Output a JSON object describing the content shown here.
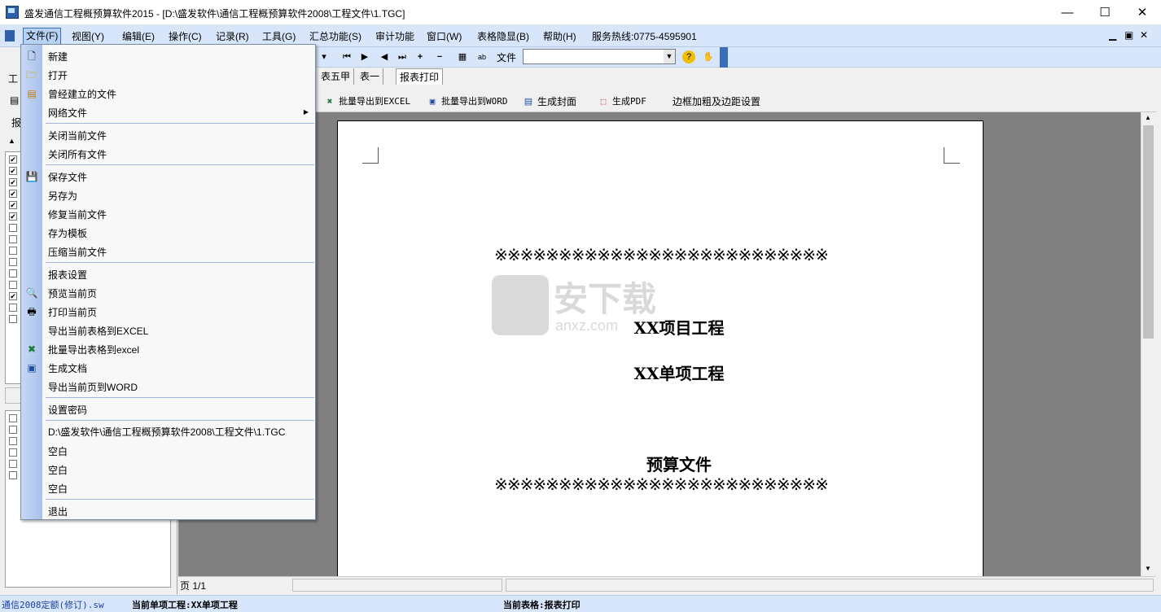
{
  "window": {
    "title": "盛发通信工程概预算软件2015 - [D:\\盛发软件\\通信工程概预算软件2008\\工程文件\\1.TGC]",
    "buttons": {
      "minimize": "—",
      "maximize": "☐",
      "close": "✕"
    }
  },
  "menubar": {
    "items": [
      "文件(F)",
      "视图(Y)",
      "编辑(E)",
      "操作(C)",
      "记录(R)",
      "工具(G)",
      "汇总功能(S)",
      "审计功能",
      "窗口(W)",
      "表格隐显(B)",
      "帮助(H)",
      "服务热线:0775-4595901"
    ]
  },
  "toolbar": {
    "file_label": "文件",
    "file_value": ""
  },
  "tabs": [
    "表五甲",
    "表一",
    "报表打印"
  ],
  "actions": {
    "export_excel": "批量导出到EXCEL",
    "export_word": "批量导出到WORD",
    "cover": "生成封面",
    "pdf": "生成PDF",
    "border": "边框加粗及边距设置"
  },
  "left": {
    "frag1": "工",
    "frag2": "报"
  },
  "file_menu": {
    "groups": [
      [
        "新建",
        "打开",
        "曾经建立的文件",
        "网络文件"
      ],
      [
        "关闭当前文件",
        "关闭所有文件"
      ],
      [
        "保存文件",
        "另存为",
        "修复当前文件",
        "存为模板",
        "压缩当前文件"
      ],
      [
        "报表设置",
        "预览当前页",
        "打印当前页",
        "导出当前表格到EXCEL",
        "批量导出表格到excel",
        "生成文档",
        "导出当前页到WORD"
      ],
      [
        "设置密码"
      ],
      [
        "D:\\盛发软件\\通信工程概预算软件2008\\工程文件\\1.TGC",
        "空白",
        "空白",
        "空白"
      ],
      [
        "退出"
      ]
    ]
  },
  "document": {
    "stars_top": "※※※※※※※※※※※※※※※※※※※※※※※※※※",
    "project": "XX项目工程",
    "item": "XX单项工程",
    "doc": "预算文件",
    "stars_bottom": "※※※※※※※※※※※※※※※※※※※※※※※※※※"
  },
  "watermark": {
    "cn": "安下载",
    "en": "anxz.com"
  },
  "pagebar": {
    "page": "页 1/1"
  },
  "statusbar": {
    "quota": "通信2008定额(修订).sw",
    "current_item": "当前单项工程:XX单项工程",
    "current_table": "当前表格:报表打印"
  },
  "colors": {
    "menubar": "#d8e6fb",
    "menu_strip": "#b7cdf0",
    "preview_bg": "#808080"
  }
}
